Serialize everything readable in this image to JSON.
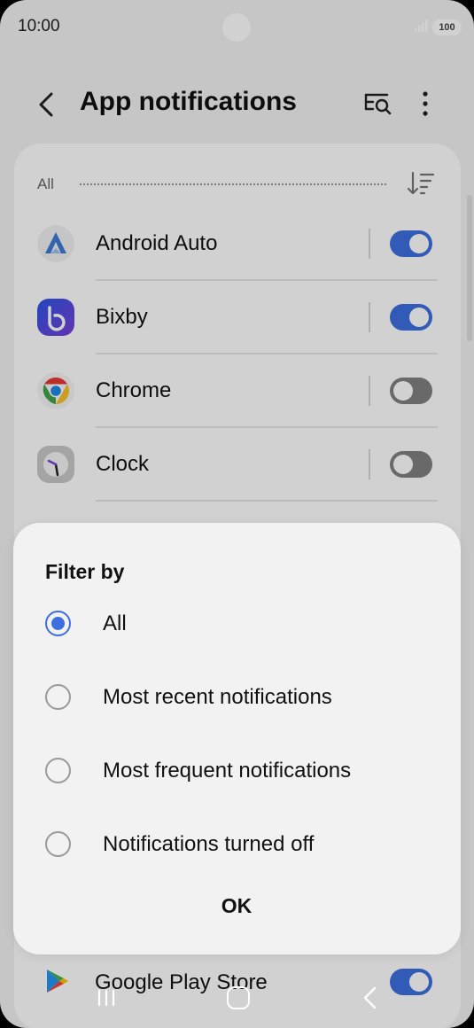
{
  "status_bar": {
    "time": "10:00",
    "battery": "100"
  },
  "header": {
    "title": "App notifications",
    "back_icon": "back-arrow-icon",
    "search_icon": "search-list-icon",
    "more_icon": "more-vertical-icon"
  },
  "filter": {
    "label": "All",
    "sort_icon": "sort-icon"
  },
  "apps": [
    {
      "name": "Android Auto",
      "enabled": true
    },
    {
      "name": "Bixby",
      "enabled": true
    },
    {
      "name": "Chrome",
      "enabled": false
    },
    {
      "name": "Clock",
      "enabled": false
    }
  ],
  "peek_app": {
    "name": "Google Play Store",
    "enabled": true
  },
  "dialog": {
    "title": "Filter by",
    "options": [
      {
        "label": "All",
        "selected": true
      },
      {
        "label": "Most recent notifications",
        "selected": false
      },
      {
        "label": "Most frequent notifications",
        "selected": false
      },
      {
        "label": "Notifications turned off",
        "selected": false
      }
    ],
    "ok_label": "OK"
  },
  "colors": {
    "accent": "#3e6fe0",
    "toggle_off": "#808080"
  }
}
